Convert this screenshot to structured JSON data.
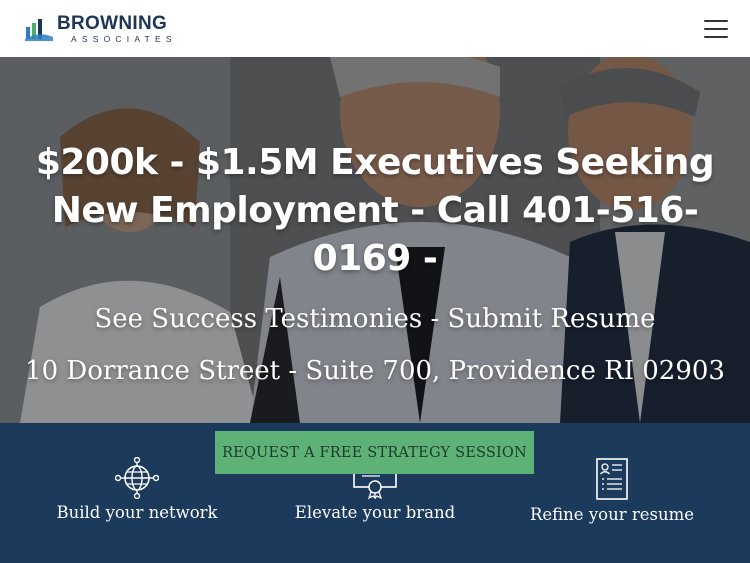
{
  "header": {
    "logo_name": "BROWNING",
    "logo_sub": "ASSOCIATES",
    "menu_icon": "hamburger-menu-icon"
  },
  "hero": {
    "title": "$200k - $1.5M Executives Seeking New Employment - Call 401-516-0169 -",
    "line2": "See Success Testimonies - Submit Resume",
    "line3": "10 Dorrance Street - Suite 700, Providence RI 02903"
  },
  "cta": {
    "label": "REQUEST A FREE STRATEGY SESSION"
  },
  "features": [
    {
      "label": "Build your network",
      "icon": "globe-network-icon"
    },
    {
      "label": "Elevate your brand",
      "icon": "certificate-icon"
    },
    {
      "label": "Refine your resume",
      "icon": "resume-document-icon"
    }
  ],
  "colors": {
    "brand_navy": "#1b3a5c",
    "cta_green": "#5fb277",
    "logo_navy": "#1d3557",
    "logo_green": "#4caf6e",
    "logo_blue": "#2a7fc1"
  }
}
